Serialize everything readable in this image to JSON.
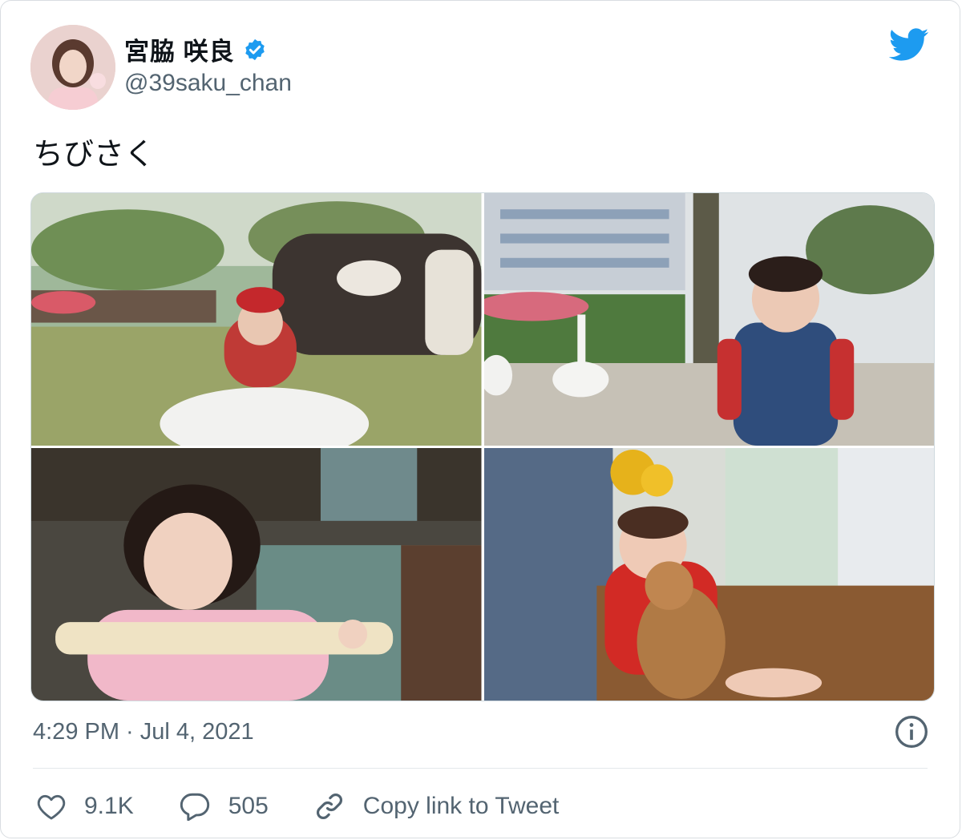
{
  "tweet": {
    "author_name": "宮脇 咲良",
    "handle": "@39saku_chan",
    "verified": true,
    "text": "ちびさく",
    "timestamp": "4:29 PM · Jul 4, 2021"
  },
  "media": {
    "photos": [
      {
        "name": "park-photo-red-cap"
      },
      {
        "name": "park-photo-swan"
      },
      {
        "name": "indoor-photo-pink-sweater"
      },
      {
        "name": "indoor-photo-teddy-bear"
      }
    ]
  },
  "actions": {
    "likes": "9.1K",
    "replies": "505",
    "copy_link_label": "Copy link to Tweet"
  },
  "icons": {
    "brand": "twitter-bird-icon",
    "verified": "verified-badge-icon",
    "info": "info-icon",
    "like": "heart-icon",
    "reply": "reply-bubble-icon",
    "link": "link-icon"
  },
  "colors": {
    "brand": "#1d9bf0",
    "text": "#0f1419",
    "secondary": "#536471"
  }
}
